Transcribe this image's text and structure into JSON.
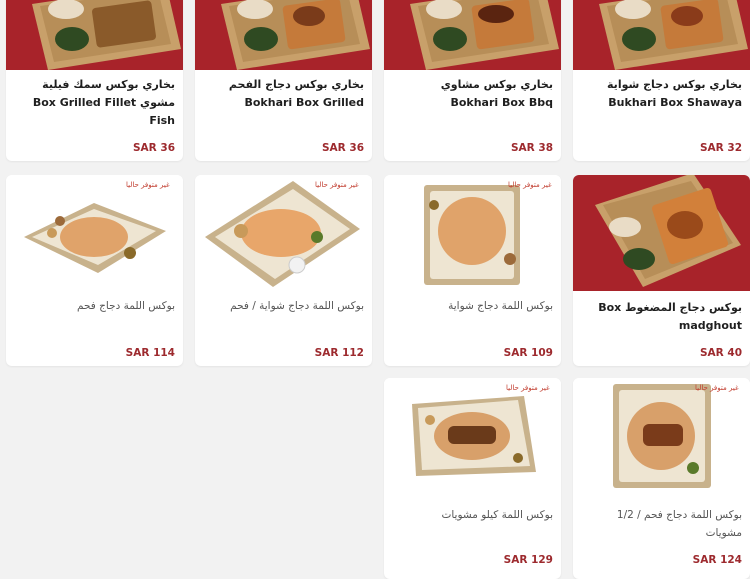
{
  "menu": {
    "items": [
      {
        "title": "بخاري بوكس سمك فيلية مشوي Box Grilled Fillet Fish",
        "price": "SAR 36",
        "available": true
      },
      {
        "title": "بخاري بوكس دجاج الفحم Bokhari Box Grilled",
        "price": "SAR 36",
        "available": true
      },
      {
        "title": "بخاري بوكس مشاوي Bokhari Box Bbq",
        "price": "SAR 38",
        "available": true
      },
      {
        "title": "بخاري بوكس دجاج شواية Bukhari Box Shawaya",
        "price": "SAR 32",
        "available": true
      },
      {
        "title": "بوكس اللمة دجاج فحم",
        "price": "SAR 114",
        "available": false,
        "badge": "غير متوفر حاليا"
      },
      {
        "title": "بوكس اللمة دجاج شواية / فحم",
        "price": "SAR 112",
        "available": false,
        "badge": "غير متوفر حاليا"
      },
      {
        "title": "بوكس اللمة دجاج شواية",
        "price": "SAR 109",
        "available": false,
        "badge": "غير متوفر حاليا"
      },
      {
        "title": "بوكس دجاج المضغوط Box madghout",
        "price": "SAR 40",
        "available": true
      },
      {
        "title": "بوكس اللمة كيلو مشويات",
        "price": "SAR 129",
        "available": false,
        "badge": "غير متوفر حاليا"
      },
      {
        "title": "بوكس اللمة دجاج فحم / 1/2 مشويات",
        "price": "SAR 124",
        "available": false,
        "badge": "غير متوفر حاليا"
      }
    ]
  },
  "colors": {
    "brand_red": "#a8232a",
    "price_red": "#9d2a2e",
    "badge_red": "#c0392b",
    "page_bg": "#f2f2f2"
  }
}
